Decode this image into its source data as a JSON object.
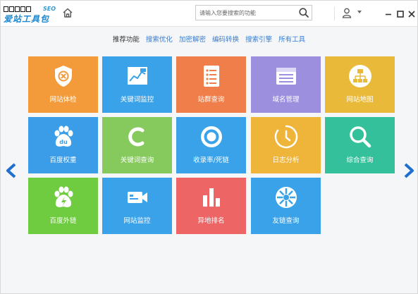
{
  "app": {
    "logo_text": "爱站工具包",
    "logo_tag": "SEO"
  },
  "search": {
    "placeholder": "请输入您要搜索的功能",
    "value": ""
  },
  "nav": {
    "items": [
      {
        "label": "推荐功能",
        "active": true
      },
      {
        "label": "搜索优化",
        "active": false
      },
      {
        "label": "加密解密",
        "active": false
      },
      {
        "label": "编码转换",
        "active": false
      },
      {
        "label": "搜索引擎",
        "active": false
      },
      {
        "label": "所有工具",
        "active": false
      }
    ]
  },
  "tiles": [
    {
      "label": "网站体检",
      "color": "#f39a3a",
      "icon": "site-checkup-icon"
    },
    {
      "label": "关键词监控",
      "color": "#3aa2e8",
      "icon": "keyword-monitor-icon"
    },
    {
      "label": "站群查询",
      "color": "#ef7e4a",
      "icon": "site-group-list-icon"
    },
    {
      "label": "域名管理",
      "color": "#9b8fde",
      "icon": "domain-manage-icon"
    },
    {
      "label": "网站地图",
      "color": "#e9b93a",
      "icon": "sitemap-icon"
    },
    {
      "label": "百度权重",
      "color": "#3b9de8",
      "icon": "baidu-paw-icon"
    },
    {
      "label": "关键词查询",
      "color": "#86c95c",
      "icon": "keyword-query-icon"
    },
    {
      "label": "收录率/死链",
      "color": "#3aa2e8",
      "icon": "ring-icon"
    },
    {
      "label": "日志分析",
      "color": "#efb43a",
      "icon": "clock-icon"
    },
    {
      "label": "综合查询",
      "color": "#33c09a",
      "icon": "magnifier-icon"
    },
    {
      "label": "百度外链",
      "color": "#6fcb3f",
      "icon": "baidu-paw-bolt-icon"
    },
    {
      "label": "网站监控",
      "color": "#3aa2e8",
      "icon": "camera-icon"
    },
    {
      "label": "异地排名",
      "color": "#ee6565",
      "icon": "bar-chart-icon"
    },
    {
      "label": "友链查询",
      "color": "#3aa2e8",
      "icon": "wheel-icon"
    }
  ]
}
